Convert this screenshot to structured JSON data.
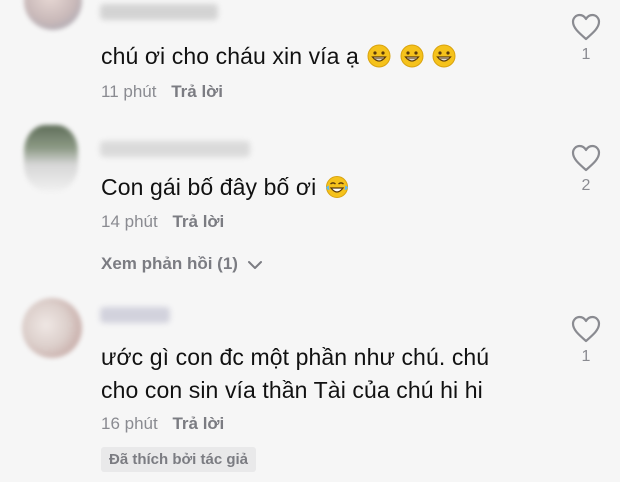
{
  "comments": [
    {
      "text": "chú ơi cho cháu xin vía ạ",
      "time": "11 phút",
      "reply_label": "Trả lời",
      "likes": "1",
      "emoji": "grinning-face"
    },
    {
      "text": "Con gái bố đây bố ơi",
      "time": "14 phút",
      "reply_label": "Trả lời",
      "likes": "2",
      "emoji": "tears-of-joy-face",
      "view_replies": "Xem phản hồi (1)"
    },
    {
      "text_line1": "ước gì con đc một phần như chú. chú",
      "text_line2": "cho con sin vía thần Tài của chú hi hi",
      "time": "16 phút",
      "reply_label": "Trả lời",
      "likes": "1",
      "badge": "Đã thích bởi tác giả"
    }
  ],
  "colors": {
    "background": "#f6f6f6",
    "text": "#111111",
    "meta": "#8a8b91",
    "emoji": "#f5c21b"
  }
}
